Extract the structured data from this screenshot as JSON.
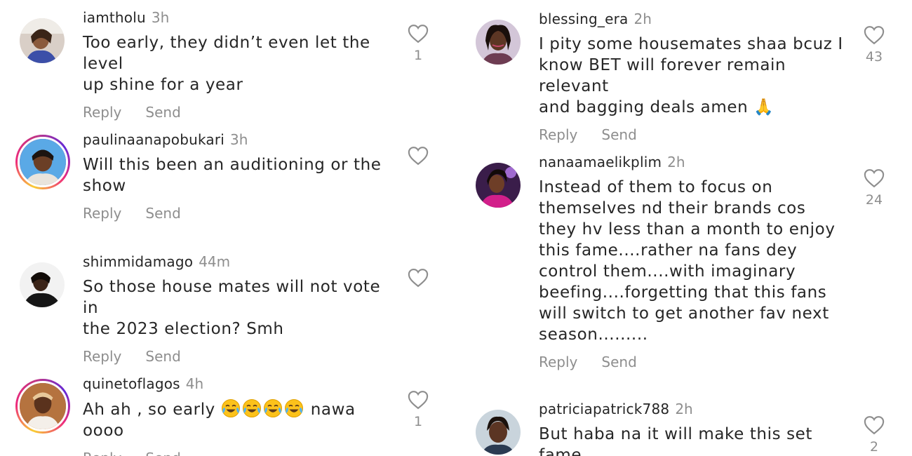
{
  "comments_left": [
    {
      "username": "iamtholu",
      "time": "3h",
      "text": "Too early, they didn’t even let the level\nup shine for a year",
      "reply_label": "Reply",
      "send_label": "Send",
      "like_count": "1",
      "avatar_story_ring": false
    },
    {
      "username": "paulinaanapobukari",
      "time": "3h",
      "text": "Will this been an auditioning or the\nshow",
      "reply_label": "Reply",
      "send_label": "Send",
      "like_count": "",
      "avatar_story_ring": true
    },
    {
      "username": "shimmidamago",
      "time": "44m",
      "text": "So those house mates will not vote in\nthe 2023 election? Smh",
      "reply_label": "Reply",
      "send_label": "Send",
      "like_count": "",
      "avatar_story_ring": false
    },
    {
      "username": "quinetoflagos",
      "time": "4h",
      "text_before_emoji": "Ah ah , so early ",
      "emoji_count": 4,
      "emoji_name": "face-with-tears-of-joy-emoji",
      "text_after_emoji": " nawa oooo",
      "reply_label": "Reply",
      "send_label": "Send",
      "like_count": "1",
      "avatar_story_ring": true
    }
  ],
  "comments_right": [
    {
      "username": "blessing_era",
      "time": "2h",
      "text": "I pity some housemates shaa bcuz I\nknow BET will forever remain relevant\nand bagging deals amen 🙏",
      "reply_label": "Reply",
      "send_label": "Send",
      "like_count": "43",
      "avatar_story_ring": false
    },
    {
      "username": "nanaamaelikplim",
      "time": "2h",
      "text": "Instead of them to focus on\nthemselves nd their brands cos\nthey hv less than a month to enjoy\nthis fame....rather na fans dey\ncontrol them....with imaginary\nbeefing....forgetting that this fans\nwill switch to get another fav next\nseason.........",
      "reply_label": "Reply",
      "send_label": "Send",
      "like_count": "24",
      "avatar_story_ring": false
    },
    {
      "username": "patriciapatrick788",
      "time": "2h",
      "text": "But haba na it will make this set fame",
      "reply_label": "",
      "send_label": "",
      "like_count": "2",
      "avatar_story_ring": false
    }
  ],
  "icons": {
    "like": "heart-outline-icon"
  },
  "colors": {
    "text": "#262626",
    "secondary": "#8e8e8e",
    "story_ring_start": "#f9ce34",
    "story_ring_mid": "#ee2a7b",
    "story_ring_end": "#6228d7"
  }
}
